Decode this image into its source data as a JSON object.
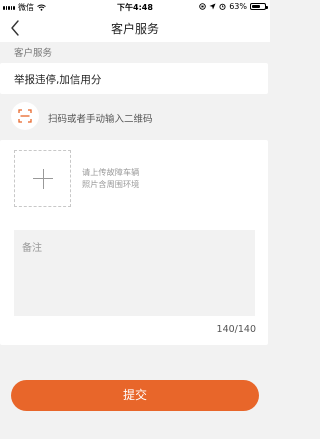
{
  "status_bar": {
    "carrier": "微信",
    "time": "下午4:48",
    "battery_percent": "63%",
    "battery_level": 0.63
  },
  "nav": {
    "title": "客户服务",
    "back_icon": "chevron-left-icon"
  },
  "form": {
    "section_label": "客户服务",
    "report_type": "举报违停,加信用分",
    "scan_label": "扫码或者手动输入二维码",
    "scan_icon": "scan-frame-icon",
    "upload_hint_line1": "请上传故障车辆",
    "upload_hint_line2": "照片含周围环境",
    "notes_placeholder": "备注",
    "char_count": "140/140"
  },
  "submit_label": "提交",
  "colors": {
    "accent": "#e8662a",
    "background": "#f2f2f2"
  }
}
